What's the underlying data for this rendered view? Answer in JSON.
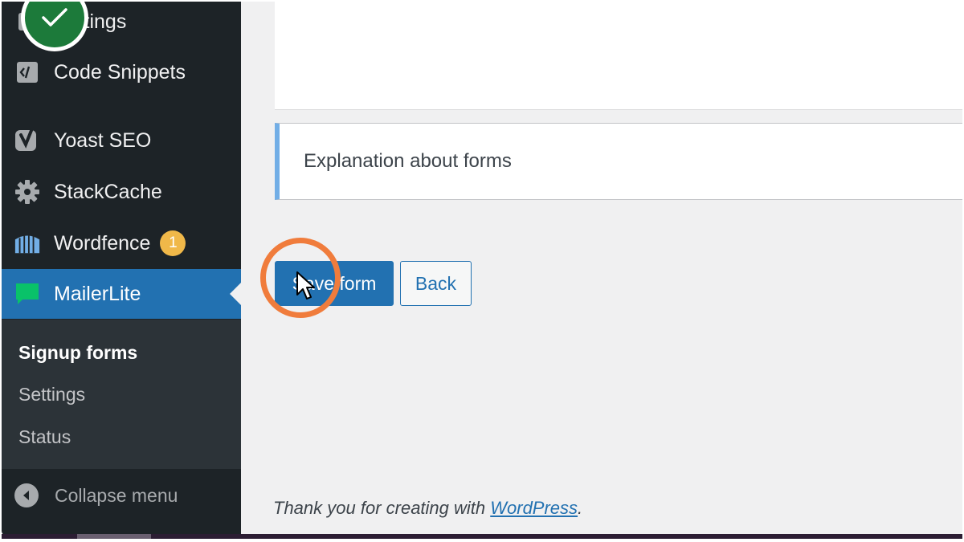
{
  "sidebar": {
    "items": [
      {
        "label": "Settings",
        "icon": "settings-icon"
      },
      {
        "label": "Code Snippets",
        "icon": "code-snippets-icon"
      },
      {
        "label": "Yoast SEO",
        "icon": "yoast-icon"
      },
      {
        "label": "StackCache",
        "icon": "gear-icon"
      },
      {
        "label": "Wordfence",
        "icon": "wordfence-icon",
        "badge": "1"
      },
      {
        "label": "MailerLite",
        "icon": "mailerlite-icon",
        "active": true
      }
    ],
    "submenu": [
      {
        "label": "Signup forms",
        "current": true
      },
      {
        "label": "Settings"
      },
      {
        "label": "Status"
      }
    ],
    "collapse_label": "Collapse menu"
  },
  "main": {
    "notice_text": "Explanation about forms",
    "save_label": "Save form",
    "back_label": "Back"
  },
  "footer": {
    "prefix": "Thank you for creating with ",
    "link": "WordPress",
    "suffix": "."
  },
  "colors": {
    "sidebar_bg": "#1d2327",
    "active_bg": "#2271b1",
    "badge": "#f0b849",
    "highlight": "#f07c3c",
    "step_check": "#1c7a3a"
  }
}
